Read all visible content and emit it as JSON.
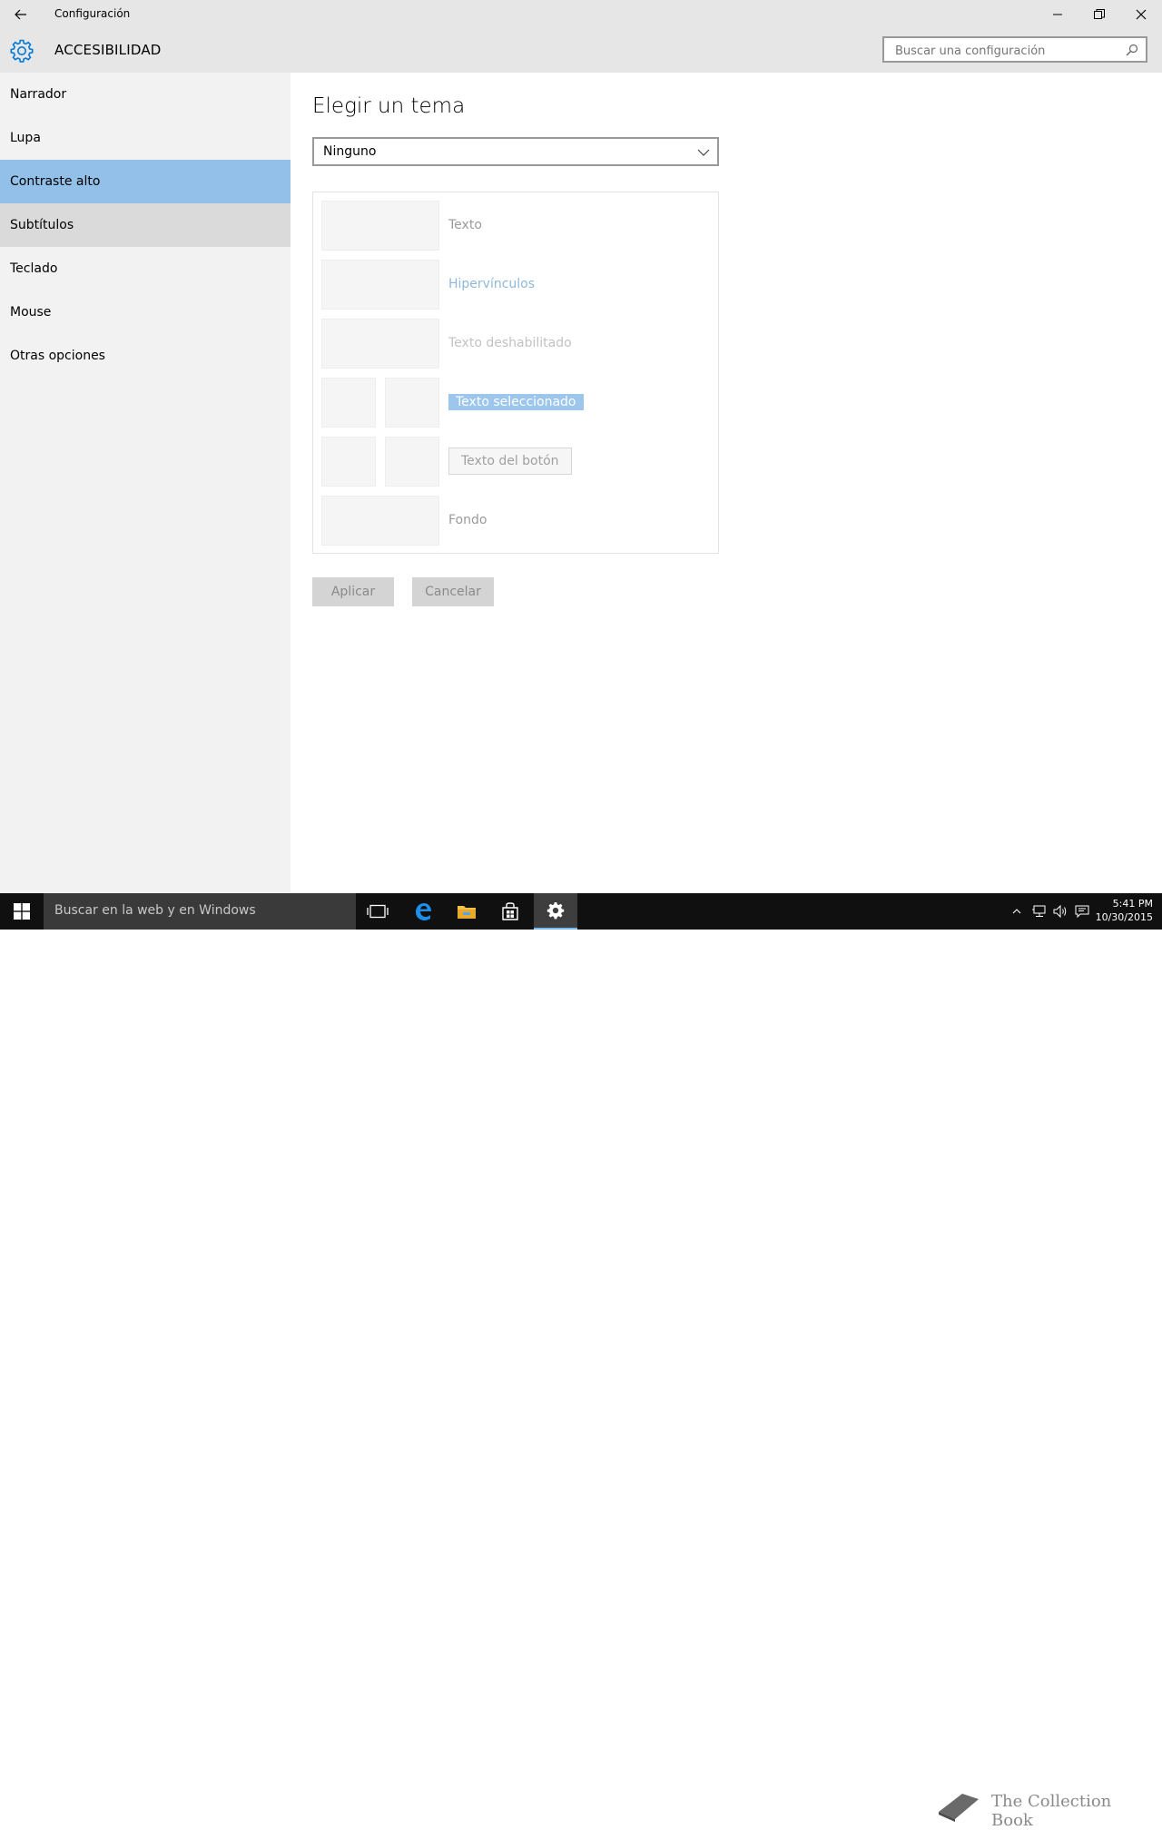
{
  "window": {
    "title": "Configuración"
  },
  "header": {
    "title": "ACCESIBILIDAD",
    "search_placeholder": "Buscar una configuración"
  },
  "sidebar": {
    "items": [
      {
        "label": "Narrador",
        "state": "normal"
      },
      {
        "label": "Lupa",
        "state": "normal"
      },
      {
        "label": "Contraste alto",
        "state": "selected"
      },
      {
        "label": "Subtítulos",
        "state": "hover"
      },
      {
        "label": "Teclado",
        "state": "normal"
      },
      {
        "label": "Mouse",
        "state": "normal"
      },
      {
        "label": "Otras opciones",
        "state": "normal"
      }
    ]
  },
  "main": {
    "heading": "Elegir un tema",
    "theme_select_value": "Ninguno",
    "preview": {
      "text": "Texto",
      "hyperlinks": "Hipervínculos",
      "disabled_text": "Texto deshabilitado",
      "selected_text": "Texto seleccionado",
      "button_text": "Texto del botón",
      "background": "Fondo"
    },
    "apply_label": "Aplicar",
    "cancel_label": "Cancelar"
  },
  "taskbar": {
    "search_placeholder": "Buscar en la web y en Windows",
    "time": "5:41 PM",
    "date": "10/30/2015",
    "watermark": "The Collection Book"
  },
  "colors": {
    "accent": "#0078d7",
    "selected_nav": "#92c0e8",
    "chrome": "#e6e6e6",
    "sidebar": "#f2f2f2",
    "taskbar": "#101010"
  }
}
